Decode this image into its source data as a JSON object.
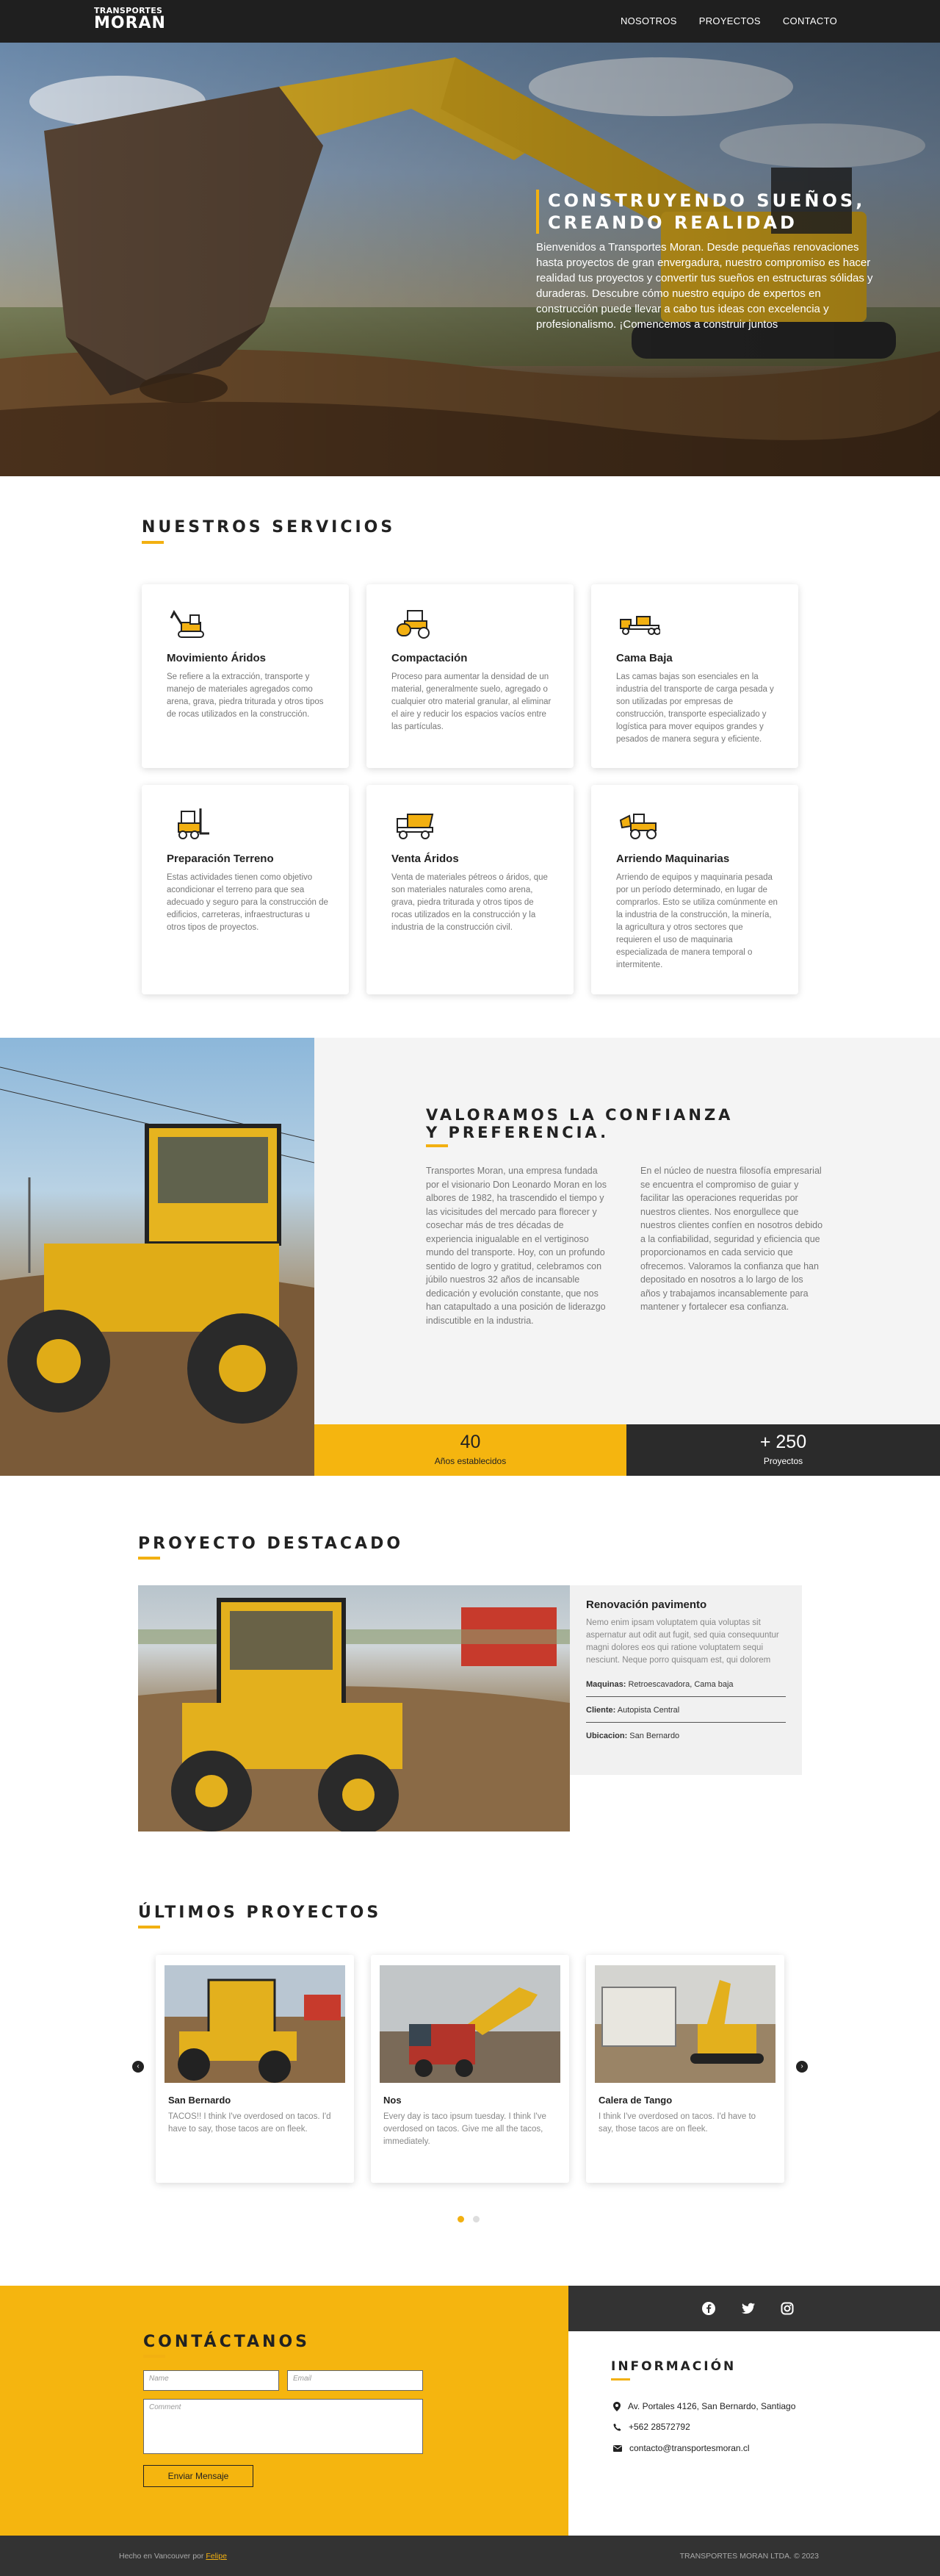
{
  "brand": {
    "line1": "TRANSPORTES",
    "line2": "MORAN"
  },
  "nav": {
    "items": [
      "NOSOTROS",
      "PROYECTOS",
      "CONTACTO"
    ]
  },
  "hero": {
    "title_line1": "CONSTRUYENDO SUEÑOS,",
    "title_line2": "CREANDO REALIDAD",
    "body": "Bienvenidos a Transportes Moran. Desde pequeñas renovaciones hasta proyectos de gran envergadura, nuestro compromiso es hacer realidad tus proyectos y convertir tus sueños en estructuras sólidas y duraderas. Descubre cómo nuestro equipo de expertos en construcción puede llevar a cabo tus ideas con excelencia y profesionalismo. ¡Comencemos a construir juntos"
  },
  "services": {
    "title": "NUESTROS SERVICIOS",
    "items": [
      {
        "icon": "excavator-icon",
        "title": "Movimiento Áridos",
        "text": "Se refiere a la extracción, transporte y manejo de materiales agregados como arena, grava, piedra triturada y otros tipos de rocas utilizados en la construcción."
      },
      {
        "icon": "roller-icon",
        "title": "Compactación",
        "text": "Proceso para aumentar la densidad de un material, generalmente suelo, agregado o cualquier otro material granular, al eliminar el aire y reducir los espacios vacíos entre las partículas."
      },
      {
        "icon": "lowbed-truck-icon",
        "title": "Cama Baja",
        "text": "Las camas bajas son esenciales en la industria del transporte de carga pesada y son utilizadas por empresas de construcción, transporte especializado y logística para mover equipos grandes y pesados de manera segura y eficiente."
      },
      {
        "icon": "forklift-icon",
        "title": "Preparación Terreno",
        "text": "Estas actividades tienen como objetivo acondicionar el terreno para que sea adecuado y seguro para la construcción de edificios, carreteras, infraestructuras u otros tipos de proyectos."
      },
      {
        "icon": "dump-truck-icon",
        "title": "Venta Áridos",
        "text": "Venta de materiales pétreos o áridos, que son materiales naturales como arena, grava, piedra triturada y otros tipos de rocas utilizados en la construcción y la industria de la construcción civil."
      },
      {
        "icon": "loader-icon",
        "title": "Arriendo Maquinarias",
        "text": "Arriendo de equipos y maquinaria pesada por un período determinado, en lugar de comprarlos. Esto se utiliza comúnmente en la industria de la construcción, la minería, la agricultura y otros sectores que requieren el uso de maquinaria especializada de manera temporal o intermitente."
      }
    ]
  },
  "about": {
    "title_line1": "VALORAMOS LA CONFIANZA",
    "title_line2": "Y PREFERENCIA.",
    "col1": "Transportes Moran, una empresa fundada por el visionario Don Leonardo Moran en los albores de 1982, ha trascendido el tiempo y las vicisitudes del mercado para florecer y cosechar más de tres décadas de experiencia inigualable en el vertiginoso mundo del transporte. Hoy, con un profundo sentido de logro y gratitud, celebramos con júbilo nuestros 32 años de incansable dedicación y evolución constante, que nos han catapultado a una posición de liderazgo indiscutible en la industria.",
    "col2": "En el núcleo de nuestra filosofía empresarial se encuentra el compromiso de guiar y facilitar las operaciones requeridas por nuestros clientes. Nos enorgullece que nuestros clientes confíen en nosotros debido a la confiabilidad, seguridad y eficiencia que proporcionamos en cada servicio que ofrecemos. Valoramos la confianza que han depositado en nosotros a lo largo de los años y trabajamos incansablemente para mantener y fortalecer esa confianza.",
    "stats": [
      {
        "num": "40",
        "label": "Años establecidos"
      },
      {
        "num": "+ 250",
        "label": "Proyectos"
      }
    ]
  },
  "featured": {
    "title": "PROYECTO DESTACADO",
    "name": "Renovación pavimento",
    "desc": "Nemo enim ipsam voluptatem quia voluptas sit aspernatur aut odit aut fugit, sed quia consequuntur magni dolores eos qui ratione voluptatem sequi nesciunt. Neque porro quisquam est, qui dolorem",
    "meta": [
      {
        "key": "Maquinas:",
        "value": "Retroescavadora, Cama baja"
      },
      {
        "key": "Cliente:",
        "value": "Autopista Central"
      },
      {
        "key": "Ubicacion:",
        "value": "San Bernardo"
      }
    ]
  },
  "latest": {
    "title": "ÚLTIMOS PROYECTOS",
    "items": [
      {
        "title": "San Bernardo",
        "text": "TACOS!! I think I've overdosed on tacos. I'd have to say, those tacos are on fleek."
      },
      {
        "title": "Nos",
        "text": "Every day is taco ipsum tuesday. I think I've overdosed on tacos. Give me all the tacos, immediately."
      },
      {
        "title": "Calera de Tango",
        "text": "I think I've overdosed on tacos. I'd have to say, those tacos are on fleek."
      }
    ],
    "prev": "‹",
    "next": "›"
  },
  "contact": {
    "title": "CONTÁCTANOS",
    "name_placeholder": "Name",
    "email_placeholder": "Email",
    "comment_placeholder": "Comment",
    "send": "Enviar Mensaje"
  },
  "info": {
    "title": "INFORMACIÓN",
    "address": "Av. Portales 4126, San Bernardo, Santiago",
    "phone": "+562 28572792",
    "email": "contacto@transportesmoran.cl"
  },
  "footer": {
    "left_prefix": "Hecho en Vancouver por",
    "left_link": "Felipe",
    "right": "TRANSPORTES MORAN LTDA. © 2023"
  },
  "colors": {
    "accent": "#f2b011",
    "dark": "#1f1f1f",
    "footer": "#333333"
  }
}
